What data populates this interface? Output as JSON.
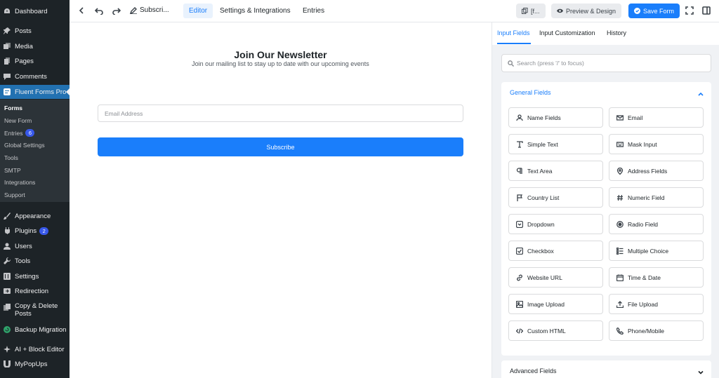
{
  "sidebar": {
    "items": [
      {
        "label": "Dashboard",
        "icon": "dashboard-icon"
      },
      {
        "label": "Posts",
        "icon": "pin-icon"
      },
      {
        "label": "Media",
        "icon": "media-icon"
      },
      {
        "label": "Pages",
        "icon": "pages-icon"
      },
      {
        "label": "Comments",
        "icon": "comment-icon"
      },
      {
        "label": "Fluent Forms Pro",
        "icon": "fluent-forms-icon"
      },
      {
        "label": "Appearance",
        "icon": "paintbrush-icon"
      },
      {
        "label": "Plugins",
        "icon": "plugin-icon",
        "badge": "2"
      },
      {
        "label": "Users",
        "icon": "users-icon"
      },
      {
        "label": "Tools",
        "icon": "wrench-icon"
      },
      {
        "label": "Settings",
        "icon": "settings-icon"
      },
      {
        "label": "Redirection",
        "icon": "redirect-icon"
      },
      {
        "label": "Copy & Delete Posts",
        "icon": "copy-icon"
      },
      {
        "label": "Backup Migration",
        "icon": "backup-icon"
      },
      {
        "label": "AI + Block Editor",
        "icon": "ai-icon"
      },
      {
        "label": "MyPopUps",
        "icon": "popup-icon"
      }
    ],
    "submenu": [
      {
        "label": "Forms"
      },
      {
        "label": "New Form"
      },
      {
        "label": "Entries",
        "badge": "6"
      },
      {
        "label": "Global Settings"
      },
      {
        "label": "Tools"
      },
      {
        "label": "SMTP"
      },
      {
        "label": "Integrations"
      },
      {
        "label": "Support"
      }
    ]
  },
  "topbar": {
    "form_title": "Subscri...",
    "tabs": [
      {
        "label": "Editor",
        "active": true
      },
      {
        "label": "Settings & Integrations"
      },
      {
        "label": "Entries"
      }
    ],
    "shortcode_label": "[f...",
    "preview_label": "Preview & Design",
    "save_label": "Save Form"
  },
  "form": {
    "heading": "Join Our Newsletter",
    "subheading": "Join our mailing list to stay up to date with our upcoming events",
    "email_placeholder": "Email Address",
    "submit_label": "Subscribe"
  },
  "panel": {
    "tabs": [
      {
        "label": "Input Fields",
        "active": true
      },
      {
        "label": "Input Customization"
      },
      {
        "label": "History"
      }
    ],
    "search_placeholder": "Search (press '/' to focus)",
    "general_title": "General Fields",
    "advanced_title": "Advanced Fields",
    "fields": [
      {
        "label": "Name Fields",
        "icon": "user-icon"
      },
      {
        "label": "Email",
        "icon": "envelope-icon"
      },
      {
        "label": "Simple Text",
        "icon": "text-icon"
      },
      {
        "label": "Mask Input",
        "icon": "keyboard-icon"
      },
      {
        "label": "Text Area",
        "icon": "paragraph-icon"
      },
      {
        "label": "Address Fields",
        "icon": "location-icon"
      },
      {
        "label": "Country List",
        "icon": "flag-icon"
      },
      {
        "label": "Numeric Field",
        "icon": "hash-icon"
      },
      {
        "label": "Dropdown",
        "icon": "dropdown-icon"
      },
      {
        "label": "Radio Field",
        "icon": "radio-icon"
      },
      {
        "label": "Checkbox",
        "icon": "checkbox-icon"
      },
      {
        "label": "Multiple Choice",
        "icon": "list-icon"
      },
      {
        "label": "Website URL",
        "icon": "link-icon"
      },
      {
        "label": "Time & Date",
        "icon": "calendar-icon"
      },
      {
        "label": "Image Upload",
        "icon": "image-icon"
      },
      {
        "label": "File Upload",
        "icon": "upload-icon"
      },
      {
        "label": "Custom HTML",
        "icon": "code-icon"
      },
      {
        "label": "Phone/Mobile",
        "icon": "phone-icon"
      }
    ]
  },
  "colors": {
    "accent": "#1a7efb",
    "sidebar_bg": "#1d2327",
    "sidebar_active": "#2271b1"
  }
}
